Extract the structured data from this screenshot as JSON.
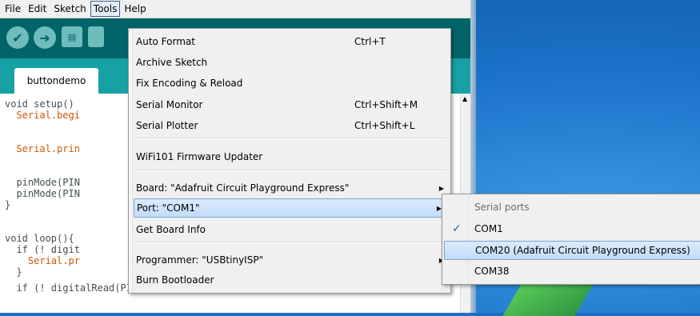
{
  "menubar": {
    "items": [
      "File",
      "Edit",
      "Sketch",
      "Tools",
      "Help"
    ],
    "active": "Tools"
  },
  "tab": {
    "label": "buttondemo"
  },
  "code": {
    "lines": [
      "void setup()",
      "  Serial.begi",
      "",
      "  Serial.prin",
      "",
      "  pinMode(PIN",
      "  pinMode(PIN",
      "}",
      "",
      "void loop(){",
      "  if (! digit",
      "    Serial.pr",
      "  }",
      "  if (! digitalRead(PIN_BUTTON_B)) {"
    ]
  },
  "tools_menu": {
    "items": [
      {
        "label": "Auto Format",
        "shortcut": "Ctrl+T"
      },
      {
        "label": "Archive Sketch",
        "shortcut": ""
      },
      {
        "label": "Fix Encoding & Reload",
        "shortcut": ""
      },
      {
        "label": "Serial Monitor",
        "shortcut": "Ctrl+Shift+M"
      },
      {
        "label": "Serial Plotter",
        "shortcut": "Ctrl+Shift+L"
      },
      {
        "label": "WiFi101 Firmware Updater",
        "shortcut": ""
      },
      {
        "label": "Board: \"Adafruit Circuit Playground Express\"",
        "shortcut": ""
      },
      {
        "label": "Port: \"COM1\"",
        "shortcut": ""
      },
      {
        "label": "Get Board Info",
        "shortcut": ""
      },
      {
        "label": "Programmer: \"USBtinyISP\"",
        "shortcut": ""
      },
      {
        "label": "Burn Bootloader",
        "shortcut": ""
      }
    ]
  },
  "port_submenu": {
    "header": "Serial ports",
    "items": [
      {
        "label": "COM1",
        "checked": true
      },
      {
        "label": "COM20 (Adafruit Circuit Playground Express)",
        "checked": false
      },
      {
        "label": "COM38",
        "checked": false
      }
    ],
    "check_glyph": "✓"
  },
  "colors": {
    "toolbar": "#006468",
    "tabstrip": "#17a1a5",
    "highlight": "#c1dbfc",
    "desktop": "#1d74c9"
  }
}
